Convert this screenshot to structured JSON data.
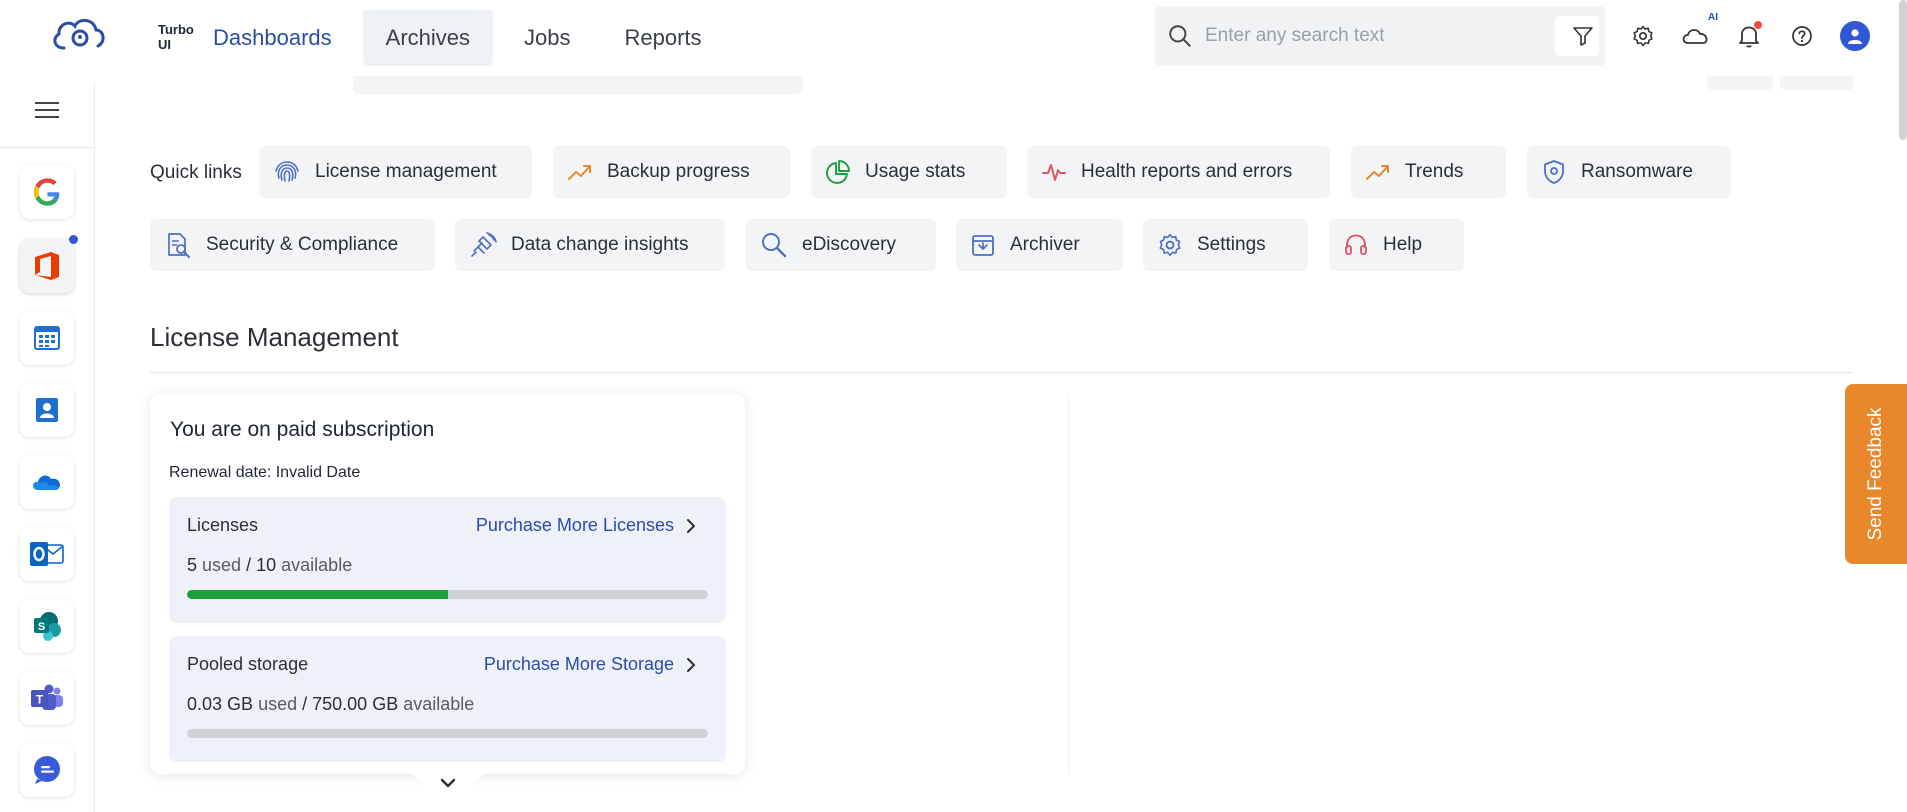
{
  "app": {
    "logo_text": "Turbo UI"
  },
  "nav": {
    "items": [
      "Dashboards",
      "Archives",
      "Jobs",
      "Reports"
    ]
  },
  "search": {
    "placeholder": "Enter any search text"
  },
  "header_icons": {
    "ai_badge": "AI"
  },
  "sidebar": {
    "apps": [
      "google-workspace",
      "office-365",
      "calendar",
      "contacts",
      "onedrive",
      "outlook",
      "sharepoint",
      "teams",
      "chat"
    ]
  },
  "quick_links": {
    "label": "Quick links",
    "items": [
      "License management",
      "Backup progress",
      "Usage stats",
      "Health reports and errors",
      "Trends",
      "Ransomware",
      "Security & Compliance",
      "Data change insights",
      "eDiscovery",
      "Archiver",
      "Settings",
      "Help"
    ]
  },
  "section": {
    "title": "License Management"
  },
  "license_card": {
    "title": "You are on paid subscription",
    "renewal": "Renewal date: Invalid Date",
    "licenses": {
      "name": "Licenses",
      "link": "Purchase More Licenses",
      "used": "5",
      "used_word": "used",
      "total": "10",
      "available_word": "available",
      "fill_fraction": 0.5
    },
    "storage": {
      "name": "Pooled storage",
      "link": "Purchase More Storage",
      "used": "0.03 GB",
      "used_word": "used",
      "total": "750.00 GB",
      "available_word": "available",
      "fill_fraction": 4e-05
    }
  },
  "feedback": {
    "label": "Send Feedback"
  },
  "colors": {
    "accent": "#2b4da8",
    "progress": "#1f9e3c",
    "feedback": "#e8882a"
  }
}
